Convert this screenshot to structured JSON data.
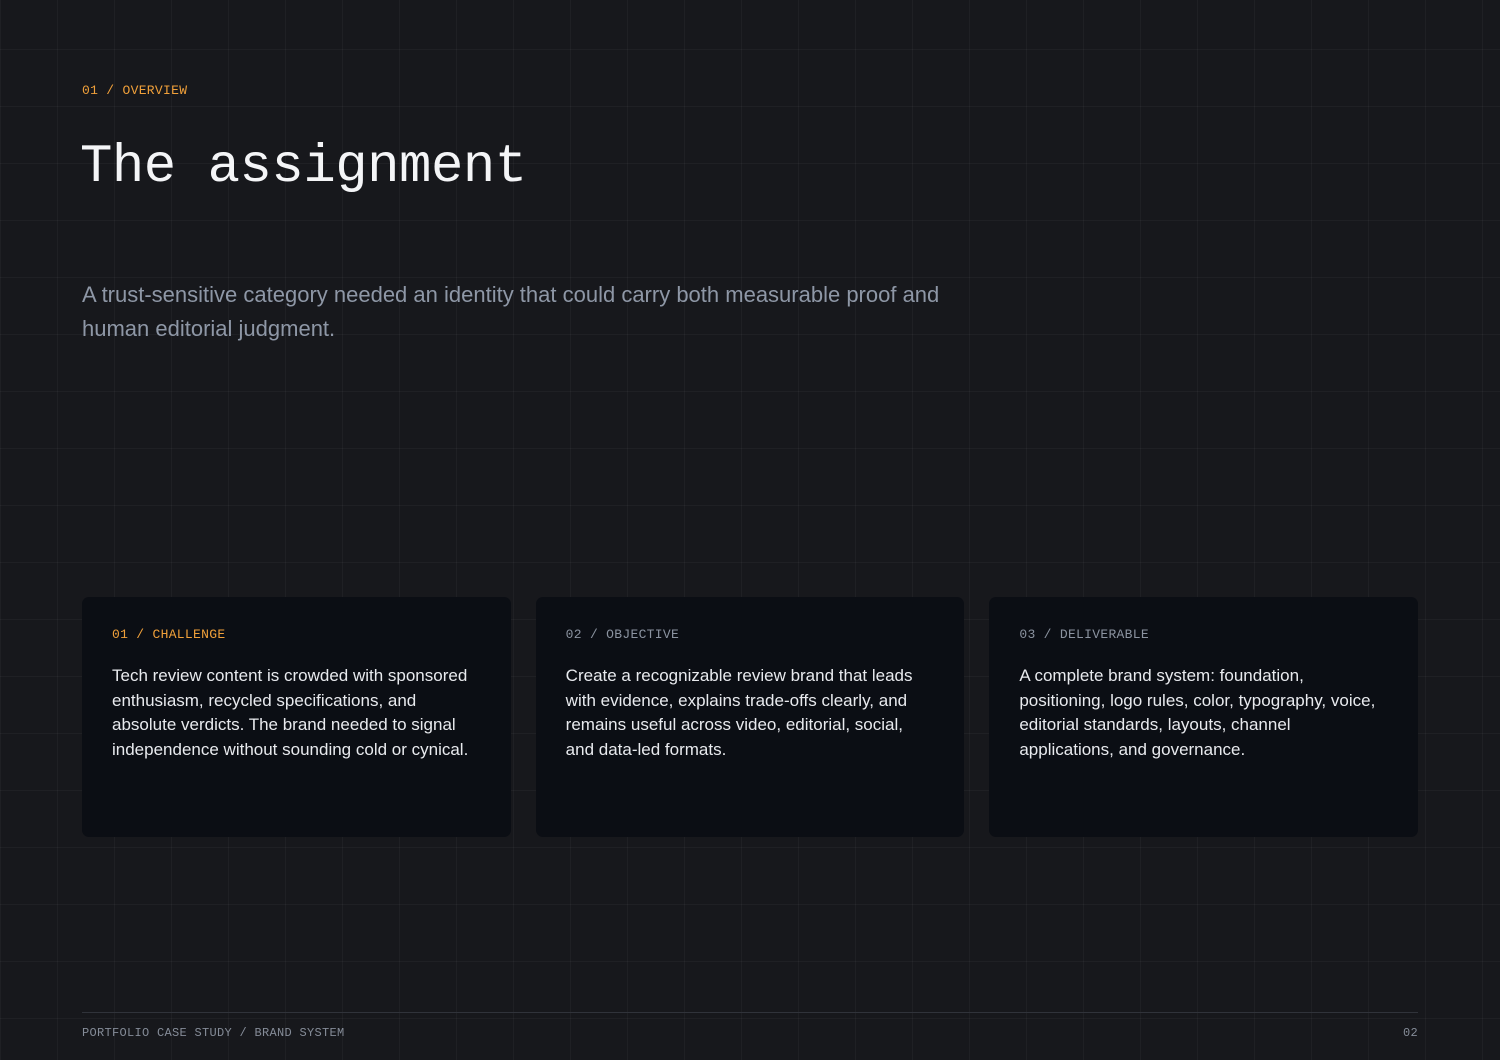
{
  "header": {
    "eyebrow": "01 / OVERVIEW",
    "title": "The assignment"
  },
  "lede": "A trust-sensitive category needed an identity that could carry both measurable proof and human editorial judgment.",
  "cards": [
    {
      "label": "01 / CHALLENGE",
      "text": "Tech review content is crowded with sponsored enthusiasm, recycled specifications, and absolute verdicts. The brand needed to signal independence without sounding cold or cynical."
    },
    {
      "label": "02 / OBJECTIVE",
      "text": "Create a recognizable review brand that leads with evidence, explains trade-offs clearly, and remains useful across video, editorial, social, and data-led formats."
    },
    {
      "label": "03 / DELIVERABLE",
      "text": "A complete brand system: foundation, positioning, logo rules, color, typography, voice, editorial standards, layouts, channel applications, and governance."
    }
  ],
  "footer": {
    "left": "PORTFOLIO CASE STUDY / BRAND SYSTEM",
    "page": "02"
  },
  "colors": {
    "background": "#17181c",
    "card": "#0b0e14",
    "accent": "#f0a03a",
    "muted": "#8e97a6"
  }
}
